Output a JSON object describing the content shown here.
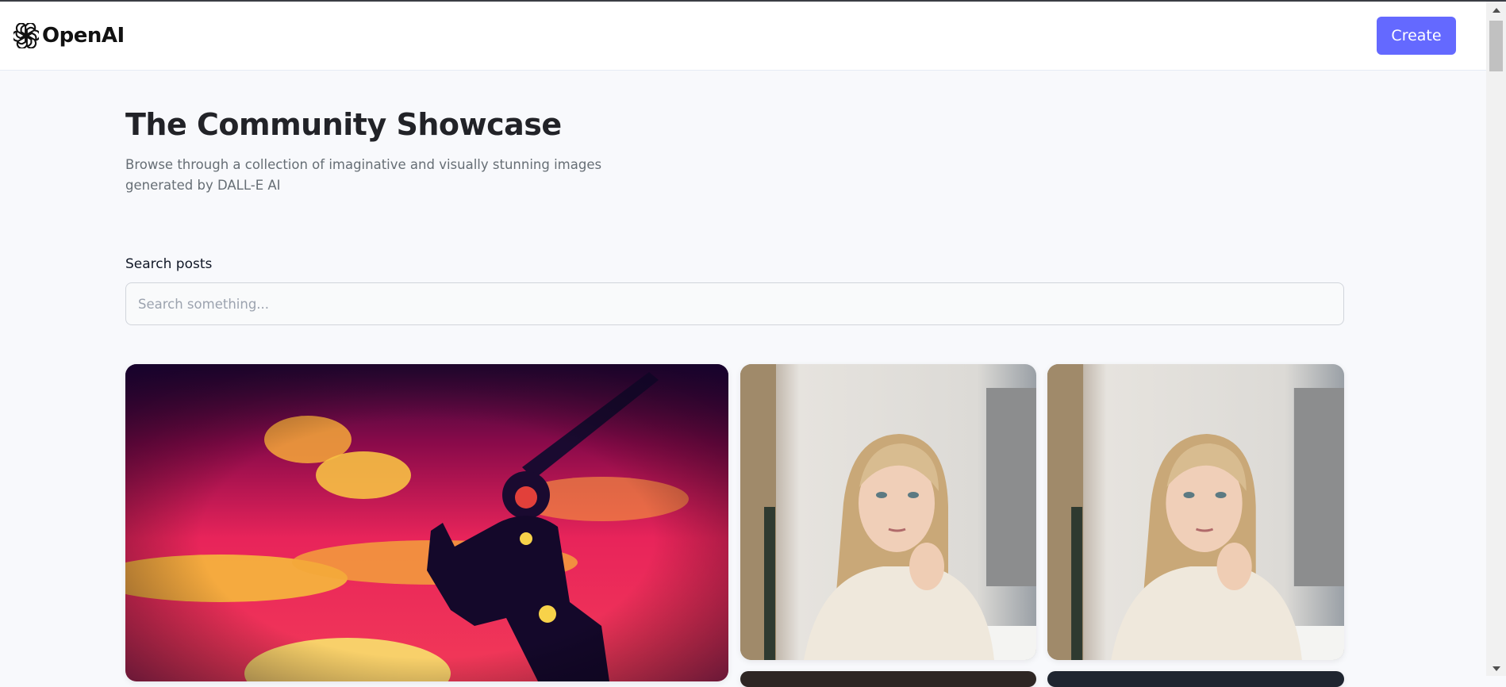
{
  "header": {
    "brand": "OpenAI",
    "logo_icon": "openai-logo-icon",
    "create_label": "Create"
  },
  "hero": {
    "title": "The Community Showcase",
    "subtitle": "Browse through a collection of imaginative and visually stunning images generated by DALL-E AI"
  },
  "search": {
    "label": "Search posts",
    "placeholder": "Search something...",
    "value": ""
  },
  "gallery": {
    "cards": [
      {
        "image": "red-sky-figure-on-horse"
      },
      {
        "image": "blonde-woman-street-portrait"
      },
      {
        "image": "blonde-woman-street-portrait"
      },
      {
        "image": "dark-image-partial"
      },
      {
        "image": "dark-image-partial"
      }
    ]
  },
  "colors": {
    "accent": "#6469ff",
    "background": "#f8f9fc",
    "title": "#222328",
    "subtitle": "#666e75"
  }
}
